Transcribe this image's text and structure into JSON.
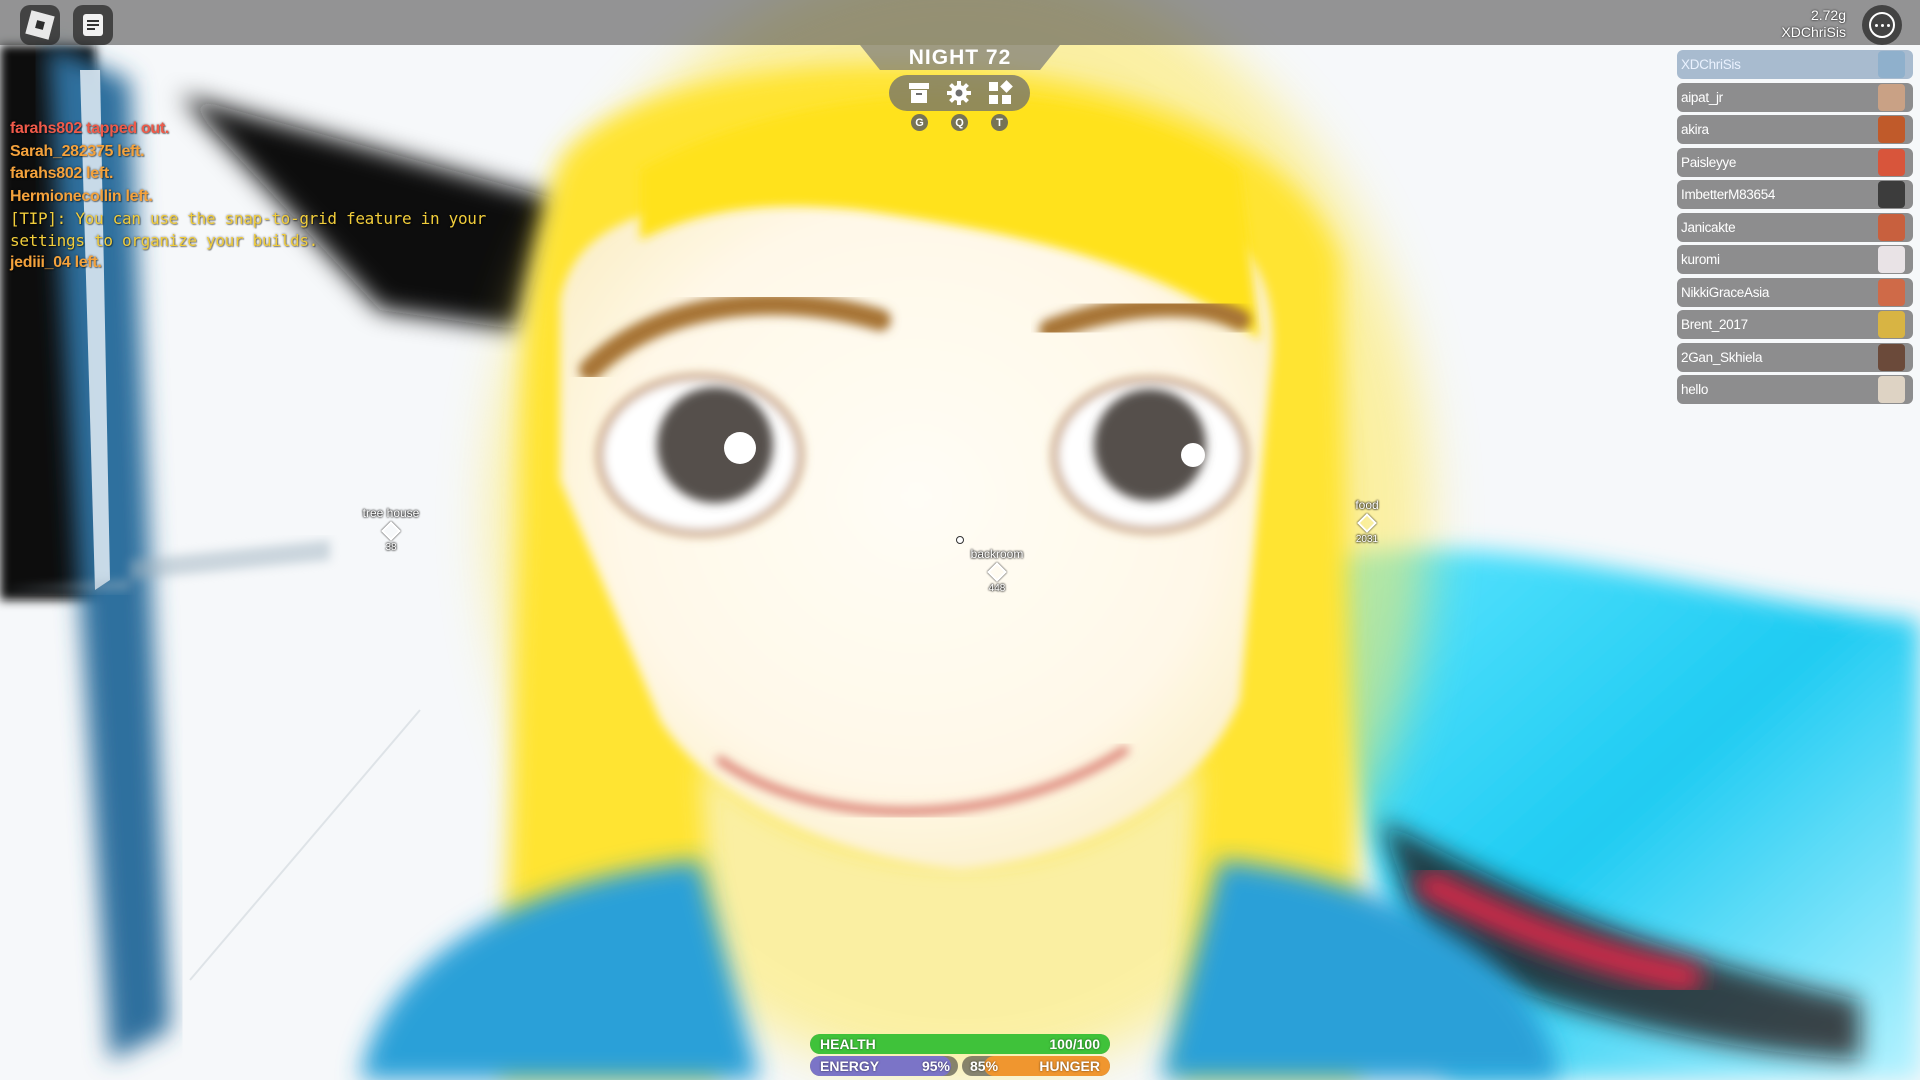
{
  "colors": {
    "health_fill": "#3fc23a",
    "energy_fill": "#7b74c7",
    "hunger_fill": "#f0962f",
    "chat_system_red": "#ef5a4a",
    "chat_system_orange": "#f4a23c",
    "chat_tip_yellow": "#f1cd3b"
  },
  "topbar": {
    "menu_icon": "roblox-logo-icon",
    "chat_icon": "chat-icon",
    "more_icon": "more-options-icon",
    "currency": "2.72g",
    "username": "XDChriSis"
  },
  "hud": {
    "night_label": "NIGHT 72",
    "tools": [
      {
        "icon": "inventory-box-icon",
        "key": "G"
      },
      {
        "icon": "settings-gear-icon",
        "key": "Q"
      },
      {
        "icon": "build-grid-icon",
        "key": "T"
      }
    ]
  },
  "chat": {
    "messages": [
      {
        "text": "farahs802 tapped out.",
        "color": "#ef5a4a"
      },
      {
        "text": "Sarah_282375 left.",
        "color": "#f4a23c"
      },
      {
        "text": "farahs802 left.",
        "color": "#f4a23c"
      },
      {
        "text": "Hermionecollin left.",
        "color": "#f4a23c"
      },
      {
        "text": "[TIP]: You can use the snap-to-grid feature in your settings to organize your builds.",
        "color": "#f1cd3b"
      },
      {
        "text": "jediii_04 left.",
        "color": "#f4a23c"
      }
    ]
  },
  "players": [
    {
      "name": "XDChriSis",
      "local": true
    },
    {
      "name": "aipat_jr"
    },
    {
      "name": "akira"
    },
    {
      "name": "Paisleyye"
    },
    {
      "name": "ImbetterM83654"
    },
    {
      "name": "Janicakte"
    },
    {
      "name": "kuromi"
    },
    {
      "name": "NikkiGraceAsia"
    },
    {
      "name": "Brent_2017"
    },
    {
      "name": "2Gan_Skhiela"
    },
    {
      "name": "hello"
    }
  ],
  "waypoints": {
    "tree_house": {
      "label": "tree house",
      "distance": "38"
    },
    "backroom": {
      "label": "backroom",
      "distance": "448"
    },
    "food": {
      "label": "food",
      "distance": "2031"
    }
  },
  "stats": {
    "health": {
      "label": "HEALTH",
      "value": "100/100",
      "fraction": 1.0
    },
    "energy": {
      "label": "ENERGY",
      "value": "95%",
      "fraction": 0.95
    },
    "hunger": {
      "label": "HUNGER",
      "value": "85%",
      "fraction": 0.85
    }
  }
}
